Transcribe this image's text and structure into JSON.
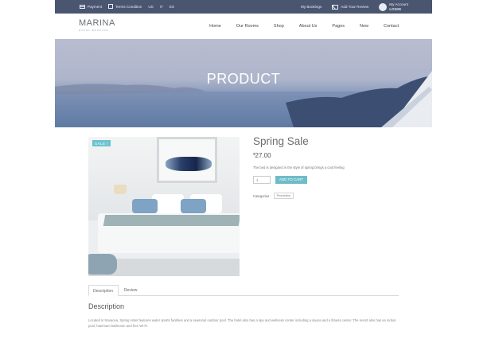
{
  "topbar": {
    "payment": "Payment",
    "terms": "Terms Condition",
    "currency_us": "US",
    "lang_it": "IT",
    "lang_es": "ES",
    "bookings": "My Bookings",
    "add_review": "Add Your Review",
    "account": "My Account",
    "login": "LOGIN"
  },
  "logo": {
    "name": "MARINA",
    "tagline": "HOTEL BOOKING"
  },
  "nav": {
    "home": "Home",
    "rooms": "Our Rooms",
    "shop": "Shop",
    "about": "About Us",
    "pages": "Pages",
    "new": "New",
    "contact": "Contact"
  },
  "hero": {
    "title": "PRODUCT"
  },
  "product": {
    "badge": "SALE !",
    "title": "Spring Sale",
    "currency": "$",
    "price": "27.00",
    "short_desc": "The bed is designed in the style of spring brings a cool feeling",
    "quantity": "1",
    "add_to_cart": "ADD TO CART",
    "categories_label": "Categories :",
    "category": "Promotion"
  },
  "tabs": {
    "description": "Description",
    "review": "Review"
  },
  "description": {
    "heading": "Description",
    "text": "Located in Novacea, Spring Hotel features water sports facilities and a seasonal outdoor pool. The hotel also has a spa and wellness center including a sauna and a fitness center. The resort also has an indoor pool, hammam bathroom and free Wi-Fi."
  },
  "colors": {
    "topbar": "#4a556f",
    "accent": "#6fbcc8"
  }
}
